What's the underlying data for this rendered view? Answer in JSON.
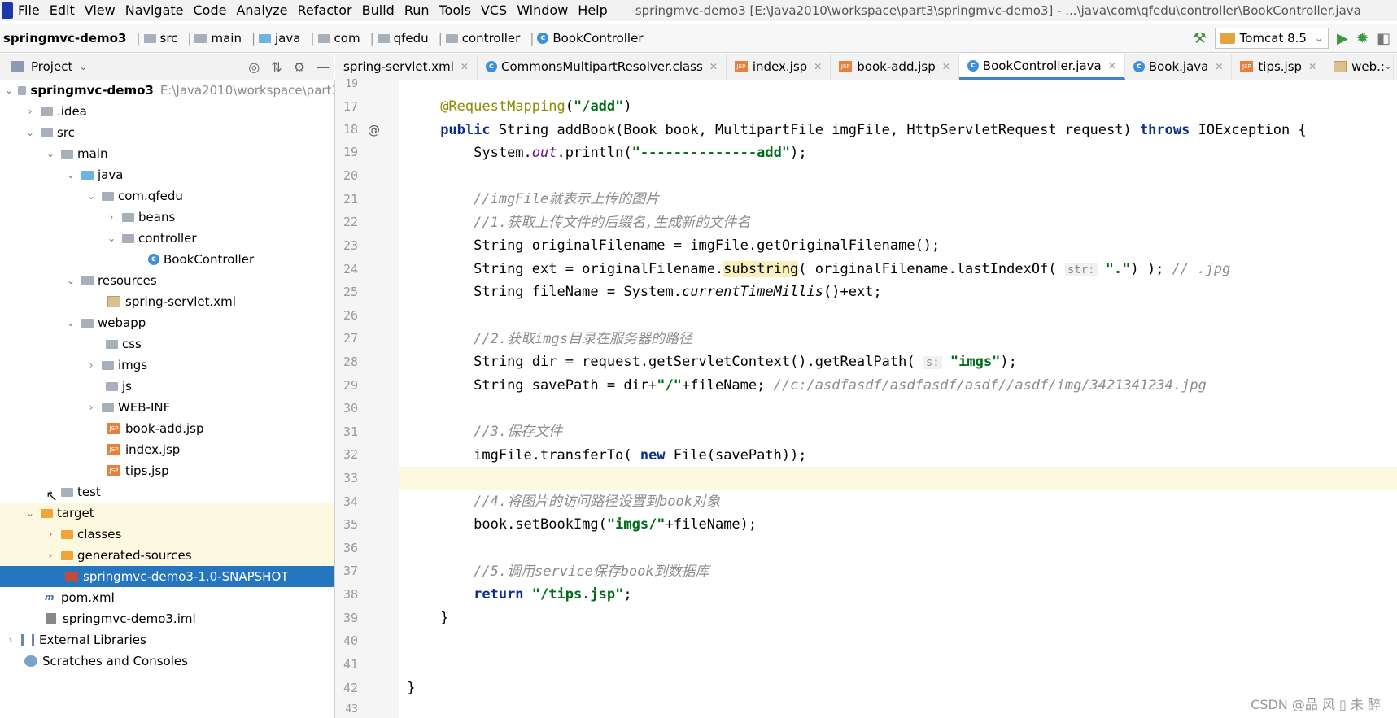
{
  "menubar": {
    "items": [
      "File",
      "Edit",
      "View",
      "Navigate",
      "Code",
      "Analyze",
      "Refactor",
      "Build",
      "Run",
      "Tools",
      "VCS",
      "Window",
      "Help"
    ],
    "title": "springmvc-demo3 [E:\\Java2010\\workspace\\part3\\springmvc-demo3] - ...\\java\\com\\qfedu\\controller\\BookController.java"
  },
  "navbar": {
    "crumbs": [
      "springmvc-demo3",
      "src",
      "main",
      "java",
      "com",
      "qfedu",
      "controller",
      "BookController"
    ],
    "run_config": "Tomcat 8.5"
  },
  "project": {
    "header": "Project",
    "tree": [
      {
        "label": "springmvc-demo3",
        "extra": "E:\\Java2010\\workspace\\part3",
        "arrow": "v",
        "icon": "module"
      },
      {
        "label": ".idea",
        "arrow": ">",
        "icon": "folder"
      },
      {
        "label": "src",
        "arrow": "v",
        "icon": "folder"
      },
      {
        "label": "main",
        "arrow": "v",
        "icon": "folder"
      },
      {
        "label": "java",
        "arrow": "v",
        "icon": "folder-blue"
      },
      {
        "label": "com.qfedu",
        "arrow": "v",
        "icon": "package"
      },
      {
        "label": "beans",
        "arrow": ">",
        "icon": "package"
      },
      {
        "label": "controller",
        "arrow": "v",
        "icon": "package"
      },
      {
        "label": "BookController",
        "arrow": "",
        "icon": "class"
      },
      {
        "label": "resources",
        "arrow": "v",
        "icon": "folder-res"
      },
      {
        "label": "spring-servlet.xml",
        "arrow": "",
        "icon": "xml"
      },
      {
        "label": "webapp",
        "arrow": "v",
        "icon": "folder"
      },
      {
        "label": "css",
        "arrow": "",
        "icon": "folder"
      },
      {
        "label": "imgs",
        "arrow": ">",
        "icon": "folder"
      },
      {
        "label": "js",
        "arrow": "",
        "icon": "folder"
      },
      {
        "label": "WEB-INF",
        "arrow": ">",
        "icon": "folder"
      },
      {
        "label": "book-add.jsp",
        "arrow": "",
        "icon": "jsp"
      },
      {
        "label": "index.jsp",
        "arrow": "",
        "icon": "jsp"
      },
      {
        "label": "tips.jsp",
        "arrow": "",
        "icon": "jsp"
      },
      {
        "label": "test",
        "arrow": ">",
        "icon": "folder"
      },
      {
        "label": "target",
        "arrow": "v",
        "icon": "folder-orange"
      },
      {
        "label": "classes",
        "arrow": ">",
        "icon": "folder-orange"
      },
      {
        "label": "generated-sources",
        "arrow": ">",
        "icon": "folder-orange"
      },
      {
        "label": "springmvc-demo3-1.0-SNAPSHOT",
        "arrow": "",
        "icon": "jar"
      },
      {
        "label": "pom.xml",
        "arrow": "",
        "icon": "maven"
      },
      {
        "label": "springmvc-demo3.iml",
        "arrow": "",
        "icon": "iml"
      },
      {
        "label": "External Libraries",
        "arrow": ">",
        "icon": "library"
      },
      {
        "label": "Scratches and Consoles",
        "arrow": "",
        "icon": "scratch"
      }
    ]
  },
  "tabs": [
    {
      "label": "spring-servlet.xml",
      "icon": "xml"
    },
    {
      "label": "CommonsMultipartResolver.class",
      "icon": "class"
    },
    {
      "label": "index.jsp",
      "icon": "jsp"
    },
    {
      "label": "book-add.jsp",
      "icon": "jsp"
    },
    {
      "label": "BookController.java",
      "icon": "class"
    },
    {
      "label": "Book.java",
      "icon": "class"
    },
    {
      "label": "tips.jsp",
      "icon": "jsp"
    },
    {
      "label": "web.:",
      "icon": "xml"
    }
  ],
  "editor": {
    "line_numbers": [
      "19",
      "17",
      "18",
      "19",
      "20",
      "21",
      "22",
      "23",
      "24",
      "25",
      "26",
      "27",
      "28",
      "29",
      "30",
      "31",
      "32",
      "33",
      "34",
      "35",
      "36",
      "37",
      "38",
      "39",
      "40",
      "41",
      "42",
      "43"
    ],
    "code": {
      "l17_ann": "@RequestMapping",
      "l17_str": "\"/add\"",
      "l18_a": "public",
      "l18_b": " String addBook(Book book, MultipartFile imgFile, HttpServletRequest request) ",
      "l18_c": "throws",
      "l18_d": " IOException {",
      "l19_a": "System.",
      "l19_b": "out",
      "l19_c": ".println(",
      "l19_d": "\"--------------add\"",
      "l19_e": ");",
      "l21": "//imgFile就表示上传的图片",
      "l22": "//1.获取上传文件的后缀名,生成新的文件名",
      "l23": "String originalFilename = imgFile.getOriginalFilename();",
      "l24_a": "String ext = originalFilename.",
      "l24_b": "substring",
      "l24_c": "( originalFilename.lastIndexOf( ",
      "l24_hint": "str:",
      "l24_d": " \".\"",
      "l24_e": ") ); ",
      "l24_cm": "// .jpg",
      "l25_a": "String fileName = System.",
      "l25_b": "currentTimeMillis",
      "l25_c": "()+ext;",
      "l27": "//2.获取imgs目录在服务器的路径",
      "l28_a": "String dir = request.getServletContext().getRealPath( ",
      "l28_hint": "s:",
      "l28_b": " \"imgs\"",
      "l28_c": ");",
      "l29_a": "String savePath = dir+",
      "l29_b": "\"/\"",
      "l29_c": "+fileName; ",
      "l29_cm": "//c:/asdfasdf/asdfasdf/asdf//asdf/img/3421341234.jpg",
      "l31": "//3.保存文件",
      "l32_a": "imgFile.transferTo( ",
      "l32_b": "new",
      "l32_c": " File(savePath));",
      "l34": "//4.将图片的访问路径设置到book对象",
      "l35_a": "book.setBookImg(",
      "l35_b": "\"imgs/\"",
      "l35_c": "+fileName);",
      "l37": "//5.调用service保存book到数据库",
      "l38_a": "return",
      "l38_b": " \"/tips.jsp\"",
      "l38_c": ";",
      "l39": "}",
      "l42": "}"
    },
    "gutter_marker": "@"
  },
  "watermark": "CSDN @品 风 ▯ 未 醉"
}
